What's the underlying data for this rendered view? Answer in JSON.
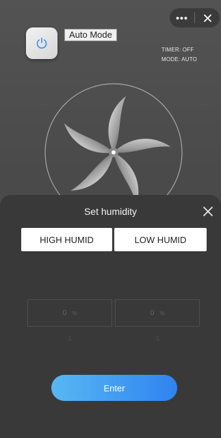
{
  "capsule": {
    "more_icon": "more-dots-icon",
    "close_icon": "close-icon",
    "more_label": "•••"
  },
  "power": {
    "icon": "power-icon",
    "color": "#3d8ee6"
  },
  "auto_mode_label": "Auto Mode",
  "status": {
    "timer": "TIMER: OFF",
    "mode": "MODE: AUTO"
  },
  "fan_icon": "fan-blades-icon",
  "sheet": {
    "title": "Set humidity",
    "close_icon": "close-icon",
    "high_label": "HIGH HUMID",
    "low_label": "LOW HUMID",
    "high_value": "0",
    "low_value": "0",
    "unit": "%",
    "high_sub": "1",
    "low_sub": "1",
    "enter_label": "Enter"
  },
  "colors": {
    "accent_start": "#57b8f3",
    "accent_end": "#2f83f0",
    "sheet_bg": "#393939",
    "bg": "#4a4a4a"
  }
}
